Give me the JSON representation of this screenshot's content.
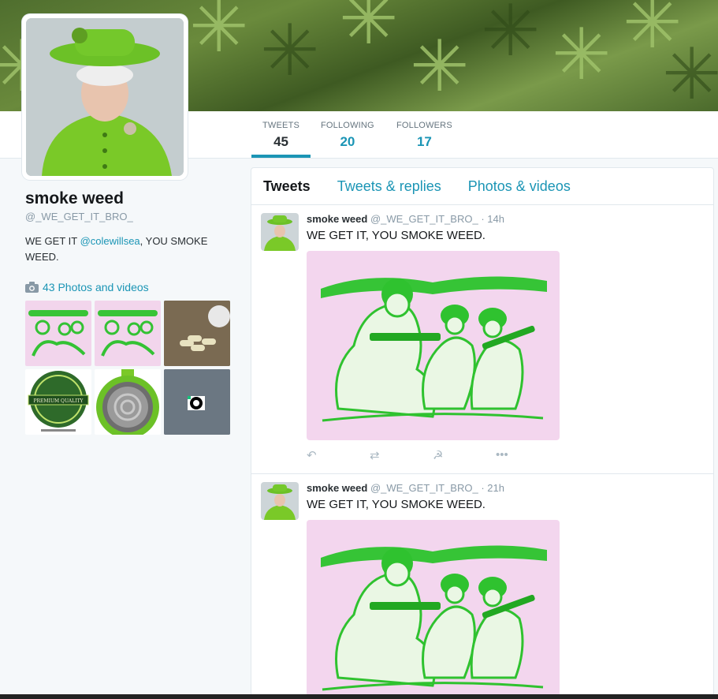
{
  "navbar": {
    "stats": [
      {
        "label": "TWEETS",
        "value": "45"
      },
      {
        "label": "FOLLOWING",
        "value": "20"
      },
      {
        "label": "FOLLOWERS",
        "value": "17"
      }
    ]
  },
  "profile": {
    "name": "smoke weed",
    "handle": "@_WE_GET_IT_BRO_",
    "bio_prefix": "WE GET IT ",
    "bio_mention": "@colewillsea",
    "bio_suffix": ", YOU SMOKE WEED.",
    "photos_label": "43 Photos and videos"
  },
  "timeline": {
    "tabs": [
      "Tweets",
      "Tweets & replies",
      "Photos & videos"
    ],
    "tweets": [
      {
        "name": "smoke weed",
        "handle": "@_WE_GET_IT_BRO_",
        "time": "· 14h",
        "text": "WE GET IT, YOU SMOKE WEED."
      },
      {
        "name": "smoke weed",
        "handle": "@_WE_GET_IT_BRO_",
        "time": "· 21h",
        "text": "WE GET IT, YOU SMOKE WEED."
      }
    ],
    "actions": [
      "reply-icon",
      "retweet-icon",
      "like-icon",
      "more-icon"
    ]
  },
  "colors": {
    "accent": "#1b95b5",
    "green": "#76c12a",
    "banner": "#5a7a33"
  },
  "thumb_badge": "PREMIUM QUALITY"
}
